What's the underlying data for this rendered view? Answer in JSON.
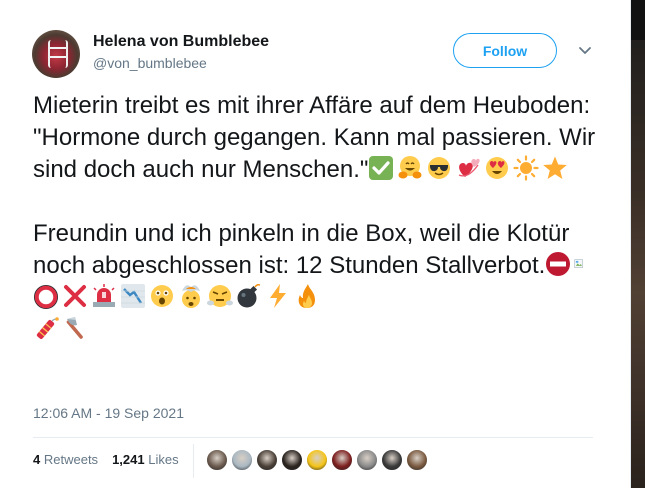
{
  "tweet": {
    "user": {
      "display_name": "Helena von Bumblebee",
      "handle": "@von_bumblebee"
    },
    "follow_label": "Follow",
    "text_paragraph_1": "Mieterin treibt es mit ihrer Affäre auf dem Heuboden: \"Hormone durch gegangen. Kann mal passieren. Wir sind doch auch nur Menschen.\"",
    "text_paragraph_2": "Freundin und ich pinkeln in die Box, weil die Klotür noch abgeschlossen ist: 12 Stunden Stallverbot.",
    "paragraph_1_emojis": [
      "check-mark-icon",
      "hugging-face-icon",
      "sunglasses-face-icon",
      "revolving-hearts-icon",
      "heart-eyes-face-icon",
      "sun-icon",
      "star-icon"
    ],
    "paragraph_2_emojis": [
      "no-entry-icon",
      "broken-image-icon",
      "red-circle-icon",
      "cross-mark-icon",
      "police-light-icon",
      "chart-decreasing-icon",
      "astonished-face-icon",
      "exploding-head-icon",
      "steam-nose-face-icon",
      "bomb-icon",
      "lightning-icon",
      "fire-icon",
      "firecracker-icon",
      "axe-icon"
    ],
    "timestamp": "12:06 AM - 19 Sep 2021",
    "retweets_count": "4",
    "retweets_label": "Retweets",
    "likes_count": "1,241",
    "likes_label": "Likes",
    "likers": [
      {
        "name": "liker-avatar-1",
        "color": "#6b5a4e"
      },
      {
        "name": "liker-avatar-2",
        "color": "#aab8c2"
      },
      {
        "name": "liker-avatar-3",
        "color": "#4a4038"
      },
      {
        "name": "liker-avatar-4",
        "color": "#2b2420"
      },
      {
        "name": "liker-avatar-5",
        "color": "#f5c518"
      },
      {
        "name": "liker-avatar-6",
        "color": "#7d1f1f"
      },
      {
        "name": "liker-avatar-7",
        "color": "#8a8a8a"
      },
      {
        "name": "liker-avatar-8",
        "color": "#3a3a3a"
      },
      {
        "name": "liker-avatar-9",
        "color": "#7a5a40"
      }
    ],
    "colors": {
      "accent": "#1da1f2",
      "text": "#14171a",
      "secondary": "#657786"
    }
  }
}
